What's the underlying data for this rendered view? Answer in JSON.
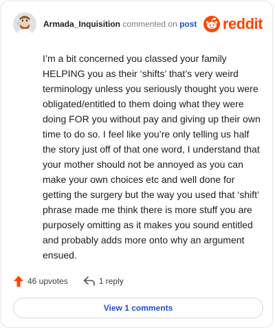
{
  "header": {
    "username": "Armada_Inquisition",
    "action_text": "commented on",
    "post_link": "post",
    "brand": "reddit"
  },
  "comment": {
    "body": "I’m a bit concerned you classed your family HELPING you as their ‘shifts’ that’s very weird terminology unless you seriously thought you were obligated/entitled to them doing what they were doing FOR you without pay and giving up their own time to do so. I feel like you’re only telling us half the story just off of that one word, I understand that your mother should not be annoyed as you can make your own choices etc and well done for getting the surgery but the way you used that ‘shift’ phrase made me think there is more stuff you are purposely omitting as it makes you sound entitled and probably adds more onto why an argument ensued."
  },
  "actions": {
    "upvotes_label": "46 upvotes",
    "reply_label": "1 reply"
  },
  "footer": {
    "view_comments_label": "View 1 comments"
  },
  "icons": {
    "upvote": "upvote-arrow-icon",
    "reply": "reply-arrow-icon",
    "brand_logo": "reddit-snoo-icon",
    "avatar": "user-avatar"
  },
  "colors": {
    "brand": "#ff4500",
    "link": "#1d4ed8",
    "upvote": "#ff4500",
    "text": "#1c1c1c"
  }
}
